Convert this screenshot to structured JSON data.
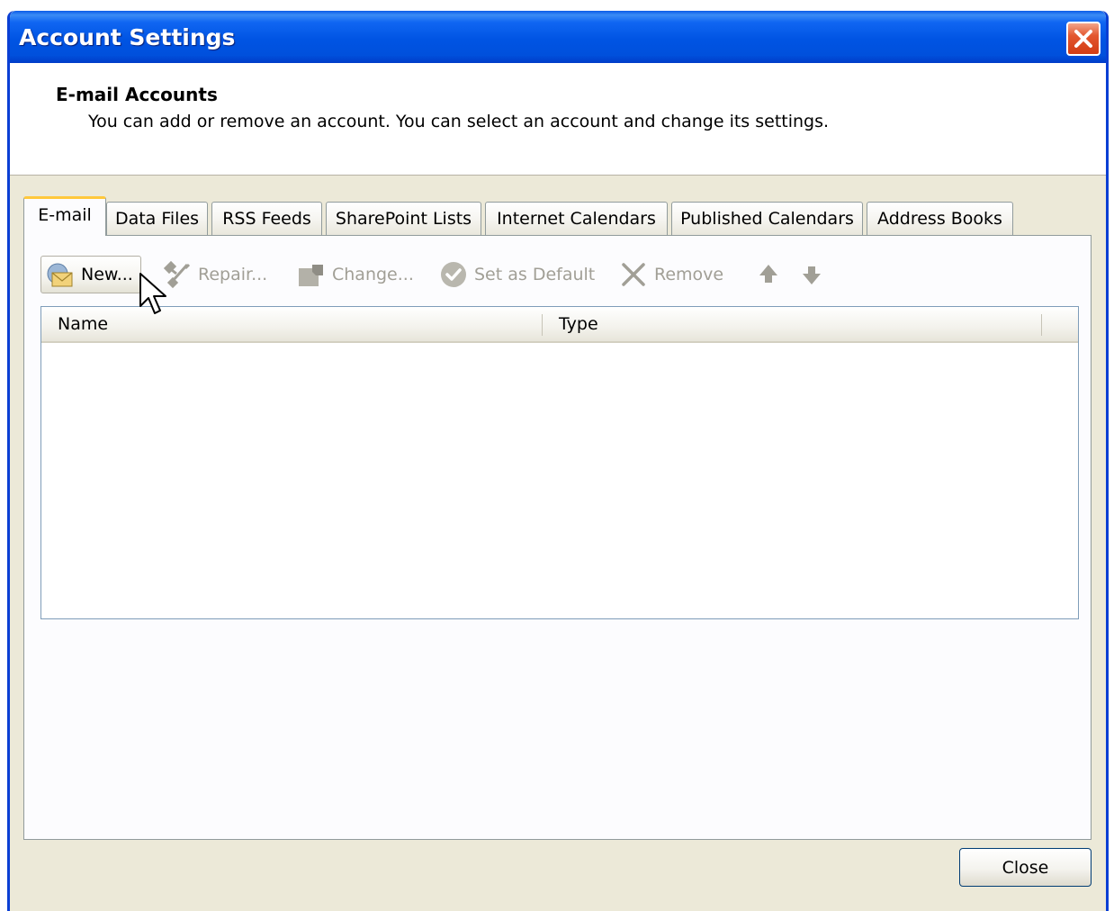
{
  "window": {
    "title": "Account Settings",
    "close_icon": "close-icon"
  },
  "header": {
    "title": "E-mail Accounts",
    "description": "You can add or remove an account. You can select an account and change its settings."
  },
  "tabs": [
    {
      "label": "E-mail",
      "active": true
    },
    {
      "label": "Data Files",
      "active": false
    },
    {
      "label": "RSS Feeds",
      "active": false
    },
    {
      "label": "SharePoint Lists",
      "active": false
    },
    {
      "label": "Internet Calendars",
      "active": false
    },
    {
      "label": "Published Calendars",
      "active": false
    },
    {
      "label": "Address Books",
      "active": false
    }
  ],
  "toolbar": {
    "new_label": "New...",
    "repair_label": "Repair...",
    "change_label": "Change...",
    "set_default_label": "Set as Default",
    "remove_label": "Remove",
    "icons": {
      "new": "mail-envelope-icon",
      "repair": "tools-icon",
      "change": "edit-icon",
      "set_default": "check-circle-icon",
      "remove": "x-icon",
      "move_up": "arrow-up-icon",
      "move_down": "arrow-down-icon"
    }
  },
  "accounts_list": {
    "columns": [
      "Name",
      "Type"
    ],
    "rows": []
  },
  "footer": {
    "close_label": "Close"
  },
  "colors": {
    "titlebar": "#0054e3",
    "dialog_bg": "#ece9d8",
    "active_tab_accent": "#ffc83c",
    "disabled_text": "#a19f96"
  }
}
